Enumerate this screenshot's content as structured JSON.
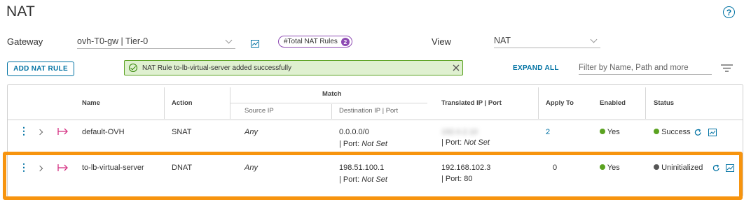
{
  "page": {
    "title": "NAT",
    "help_icon": "?"
  },
  "toolbar": {
    "gateway_label": "Gateway",
    "gateway_value": "ovh-T0-gw | Tier-0",
    "total_badge_label": "#Total NAT Rules",
    "total_badge_count": "2",
    "view_label": "View",
    "view_value": "NAT",
    "add_button": "ADD NAT RULE",
    "alert_text": "NAT Rule to-lb-virtual-server added successfully",
    "expand_all": "EXPAND ALL",
    "filter_placeholder": "Filter by Name, Path and more"
  },
  "table": {
    "headers": {
      "name": "Name",
      "action": "Action",
      "match": "Match",
      "source_ip": "Source IP",
      "destination": "Destination IP | Port",
      "translated": "Translated IP | Port",
      "apply_to": "Apply To",
      "enabled": "Enabled",
      "status": "Status"
    },
    "rows": [
      {
        "name": "default-OVH",
        "action": "SNAT",
        "source_ip": "Any",
        "destination_ip": "0.0.0.0/0",
        "destination_port_prefix": "| Port:",
        "destination_port": "Not Set",
        "translated_ip": "192.0.2.10",
        "translated_port_prefix": "| Port:",
        "translated_port": "Not Set",
        "apply_to": "2",
        "enabled": "Yes",
        "status": "Success"
      },
      {
        "name": "to-lb-virtual-server",
        "action": "DNAT",
        "source_ip": "Any",
        "destination_ip": "198.51.100.1",
        "destination_port_prefix": "| Port:",
        "destination_port": "Not Set",
        "translated_ip": "192.168.102.3",
        "translated_port_prefix": "| Port:",
        "translated_port": "80",
        "apply_to": "0",
        "enabled": "Yes",
        "status": "Uninitialized"
      }
    ]
  },
  "colors": {
    "accent": "#0072a3",
    "success_dot": "#5aa220",
    "uninitialized_dot": "#565656",
    "highlight": "#f7940e",
    "badge": "#8e4bb3"
  }
}
